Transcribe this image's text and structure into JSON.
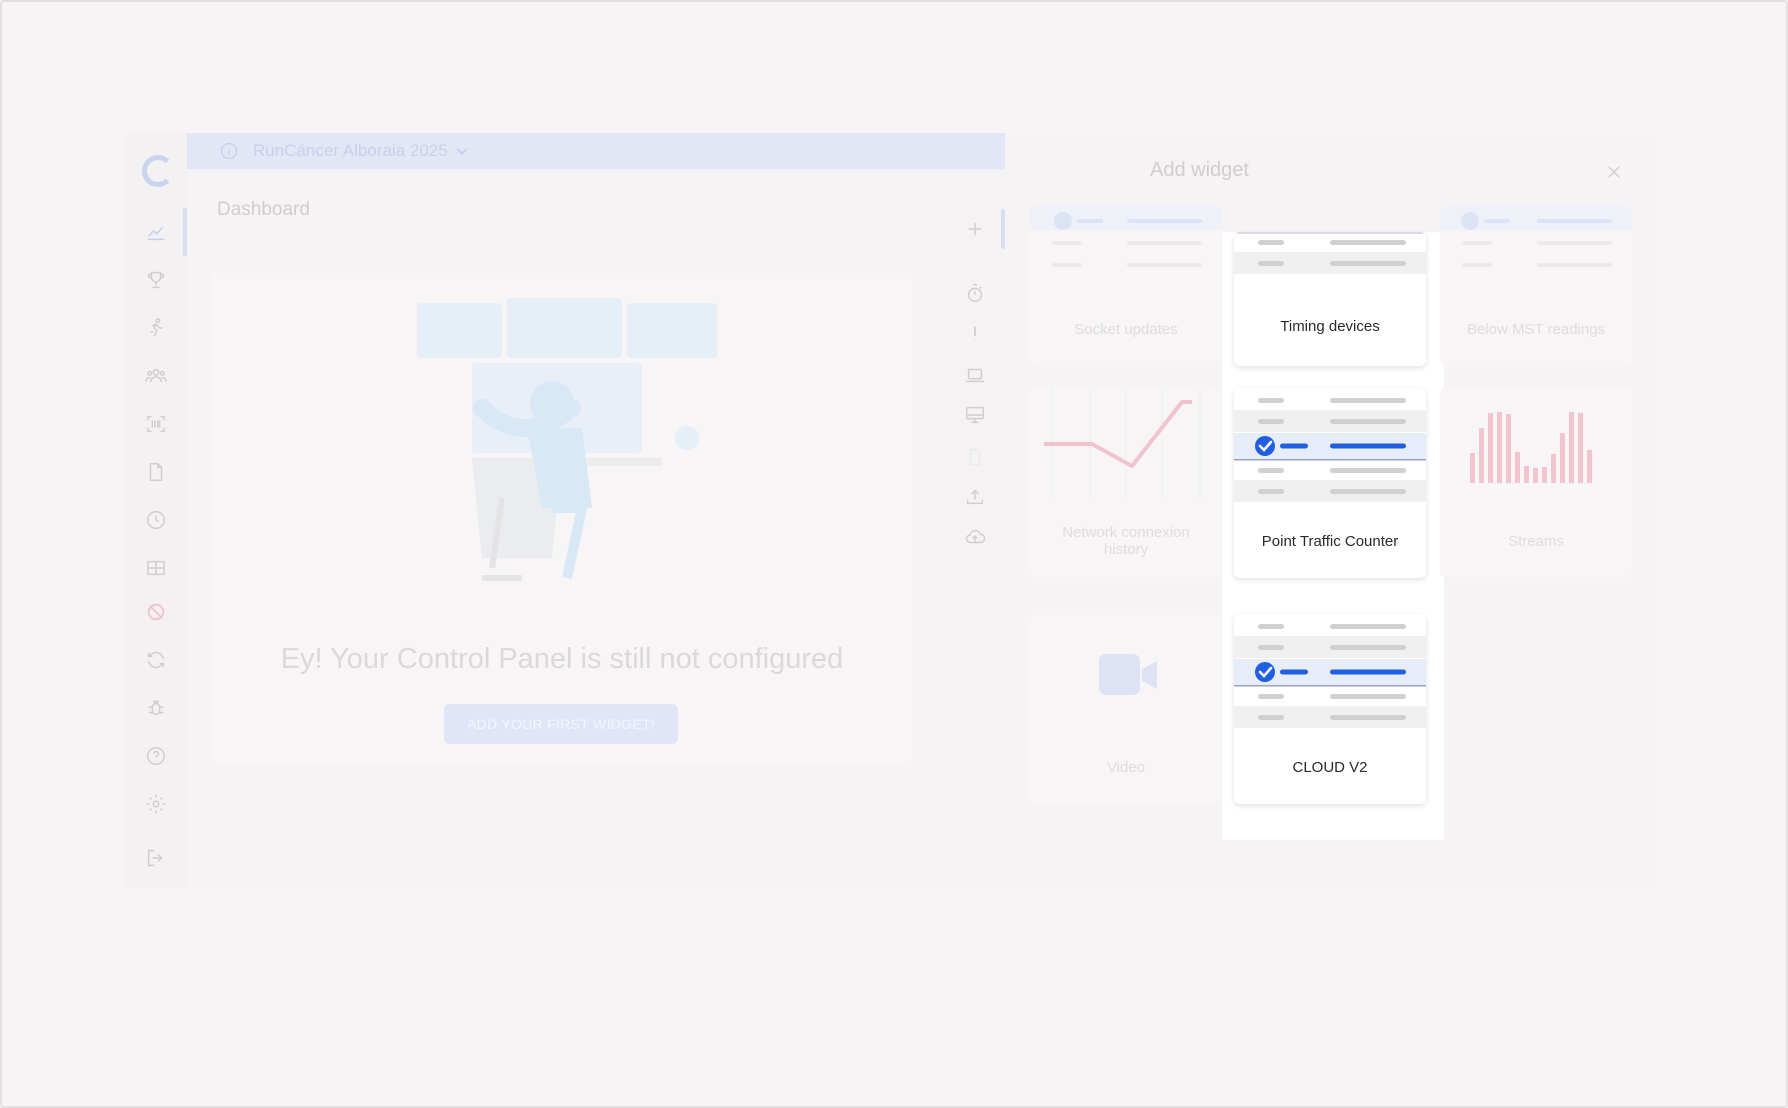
{
  "topbar": {
    "event_name": "RunCáncer Alboraia 2025"
  },
  "page": {
    "title": "Dashboard",
    "empty_title": "Ey! Your Control Panel is still not configured",
    "cta_label": "ADD YOUR FIRST WIDGET!"
  },
  "panel": {
    "title": "Add widget",
    "widgets": [
      {
        "label": "Socket updates"
      },
      {
        "label": "Timing devices"
      },
      {
        "label": "Below MST readings"
      },
      {
        "label": "Network connexion history"
      },
      {
        "label": "Point Traffic Counter"
      },
      {
        "label": "Streams"
      },
      {
        "label": "Video"
      },
      {
        "label": "CLOUD V2"
      }
    ]
  },
  "sidebar": {
    "icons": [
      "chart-line-icon",
      "trophy-icon",
      "runner-icon",
      "users-icon",
      "scan-icon",
      "document-icon",
      "clock-icon",
      "table-icon",
      "ban-icon",
      "refresh-icon",
      "bug-icon",
      "help-icon",
      "gear-icon",
      "logout-icon"
    ]
  },
  "toolbar": {
    "icons": [
      "plus-icon",
      "stopwatch-icon",
      "alert-icon",
      "laptop-icon",
      "monitor-icon",
      "upload-icon",
      "cloud-upload-icon"
    ]
  },
  "colors": {
    "accent": "#1f5fe0",
    "dim_accent": "#c9d4ee",
    "alert_line": "#f2c3cf"
  }
}
